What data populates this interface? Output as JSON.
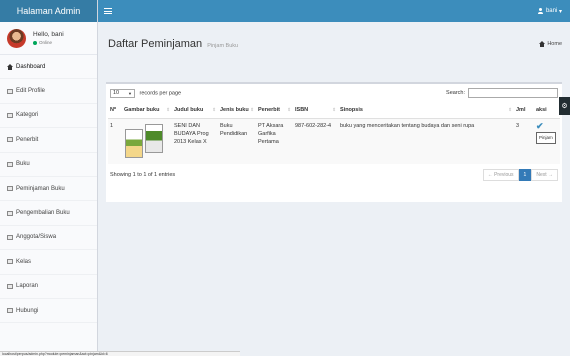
{
  "header": {
    "logo": "Halaman Admin",
    "user": "bani"
  },
  "user_panel": {
    "hello": "Hello, bani",
    "status": "Online"
  },
  "menu": [
    {
      "label": "Dashboard"
    },
    {
      "label": "Edit Profile"
    },
    {
      "label": "Kategori"
    },
    {
      "label": "Penerbit"
    },
    {
      "label": "Buku"
    },
    {
      "label": "Peminjaman Buku"
    },
    {
      "label": "Pengembalian Buku"
    },
    {
      "label": "Anggota/Siswa"
    },
    {
      "label": "Kelas"
    },
    {
      "label": "Laporan"
    },
    {
      "label": "Hubungi"
    }
  ],
  "page": {
    "title": "Daftar Peminjaman",
    "subtitle": "Pinjam Buku",
    "breadcrumb": "Home"
  },
  "table_controls": {
    "length_value": "10",
    "length_suffix": "records per page",
    "search_label": "Search:"
  },
  "table": {
    "columns": [
      "Nº",
      "Gambar buku",
      "Judul buku",
      "Jenis buku",
      "Penerbit",
      "ISBN",
      "Sinopsis",
      "Jml",
      "aksi"
    ],
    "rows": [
      {
        "no": "1",
        "judul": "SENI DAN BUDAYA Prog 2013 Kelas X",
        "jenis": "Buku Pendidikan",
        "penerbit": "PT Aksara Garfika Pertama",
        "isbn": "987-602-282-4",
        "sinopsis": "buku yang menceritakan tentang budaya dan seni rupa",
        "jml": "3",
        "action": "Pinjam"
      }
    ]
  },
  "footer": {
    "info": "Showing 1 to 1 of 1 entries",
    "prev": "← Previous",
    "page": "1",
    "next": "Next →"
  },
  "statusbar": "localhost/perpus/admin.php?module=peminjaman&act=pinjam&id=6"
}
